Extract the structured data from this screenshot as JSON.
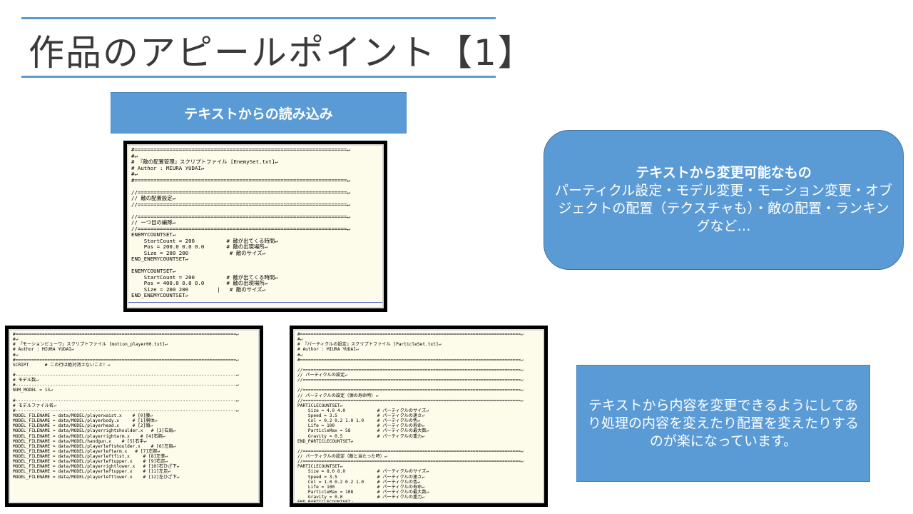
{
  "slide": {
    "title": "作品のアピールポイント【1】",
    "label": "テキストからの読み込み",
    "feature": {
      "heading": "テキストから変更可能なもの",
      "body": "パーティクル設定・モデル変更・モーション変更・オブジェクトの配置（テクスチャも）・敵の配置・ランキングなど…"
    },
    "description": "テキストから内容を変更できるようにしてあり処理の内容を変えたり配置を変えたりするのが楽になっています。"
  },
  "screenshots": {
    "enemy": "#===================================================================↵\n#↵\n# 『敵の配置管理』スクリプトファイル [EnemySet.txt]↵\n# Author : MIURA YUDAI↵\n#↵\n#===================================================================↵\n\n//==================================================================↵\n// 敵の配置設定↵\n//==================================================================↵\n\n//==================================================================↵\n// 一つ目の編隊↵\n//==================================================================↵\nENEMYCOUNTSET↵\n    StartCount = 200          # 敵が出てくる時間↵\n    Pos = 200.0 0.0 0.0       # 敵の出現場所↵\n    Size = 200 200             # 敵のサイズ↵\nEND_ENEMYCOUNTSET↵\n\nENEMYCOUNTSET↵\n    StartCount = 200          # 敵が出てくる時間↵\n    Pos = 400.0 0.0 0.0       # 敵の出現場所↵\n    Size = 200 200         |   # 敵のサイズ↵\nEND_ENEMYCOUNTSET↵",
    "motion": "#===================================================================================↵\n#↵\n# 『モーションビューワ』スクリプトファイル [motion_player00.txt]↵\n# Author : MIURA YUDAI↵\n#↵\n#===================================================================================↵\nSCRIPT      # この行は絶対消さないこと！↵\n\n#-----------------------------------------------------------------------------------↵\n# モデル数↵\n#-----------------------------------------------------------------------------------↵\nNUM_MODEL = 13↵\n\n#-----------------------------------------------------------------------------------↵\n# モデルファイル名↵\n#-----------------------------------------------------------------------------------↵\nMODEL_FILENAME = data/MODEL/playerwaist.x    # [0]腰↵\nMODEL_FILENAME = data/MODEL/playerbody.x     # [1]胴体↵\nMODEL_FILENAME = data/MODEL/playerhead.x     # [2]頭↵\nMODEL_FILENAME = data/MODEL/playerrightshoulder.x   # [3]右肩↵\nMODEL_FILENAME = data/MODEL/playerrightarm.x    # [4]右腕↵\nMODEL_FILENAME = data/MODEL/handgun.x    # [5]右手↵\nMODEL_FILENAME = data/MODEL/playerleftshoulder.x    # [6]左肩↵\nMODEL_FILENAME = data/MODEL/playerleftarm.x   # [7]左腕↵\nMODEL_FILENAME = data/MODEL/playerleftfist.x     # [8]左拳↵\nMODEL_FILENAME = data/MODEL/playerleftupper.x    # [9]右足↵\nMODEL_FILENAME = data/MODEL/playerrightlower.x   # [10]右ひざ下↵\nMODEL_FILENAME = data/MODEL/playerleftupper.x    # [11]左足↵\nMODEL_FILENAME = data/MODEL/playerleftlower.x    # [12]左ひざ下↵",
    "particle": "#===================================================================================↵\n#↵\n# 『パーティクルの設定』スクリプトファイル [ParticleSet.txt]↵\n# Author : MIURA YUDAI↵\n#↵\n#===================================================================================↵\n\n//==================================================================================↵\n// パーティクルの設定↵\n//==================================================================================↵\n\n//==================================================================================↵\n// パーティクルの設定（弾の寿命時）↵\n//==================================================================================↵\nPARTICLECOUNTSET↵\n    Size = 4.0 4.0            # パーティクルのサイズ↵\n    Speed = 3.5               # パーティクルの速さ↵\n    Col = 0.2 0.2 1.0 1.0     # パーティクルの色↵\n    Life = 100                # パーティクルの寿命↵\n    ParticleMax = 58          # パーティクルの最大数↵\n    Gravity = 0.5             # パーティクルの重力↵\nEND_PARTICLECOUNTSET↵\n\n//==================================================================================↵\n// パーティクルの設定（敵と当たった時）↵\n//==================================================================================↵\nPARTICLECOUNTSET↵\n    Size = 8.0 8.0            # パーティクルのサイズ↵\n    Speed = 3.5               # パーティクルの速さ↵\n    Col = 1.0 0.2 0.2 1.0     # パーティクルの色↵\n    Life = 100                # パーティクルの寿命↵\n    ParticleMax = 108         # パーティクルの最大数↵\n    Gravity = 0.0             # パーティクルの重力↵\nEND_PARTICLECOUNTSET↵"
  },
  "colors": {
    "accent": "#5b9bd5",
    "title_text": "#3a3a3a",
    "code_bg": "#fdfcea"
  }
}
